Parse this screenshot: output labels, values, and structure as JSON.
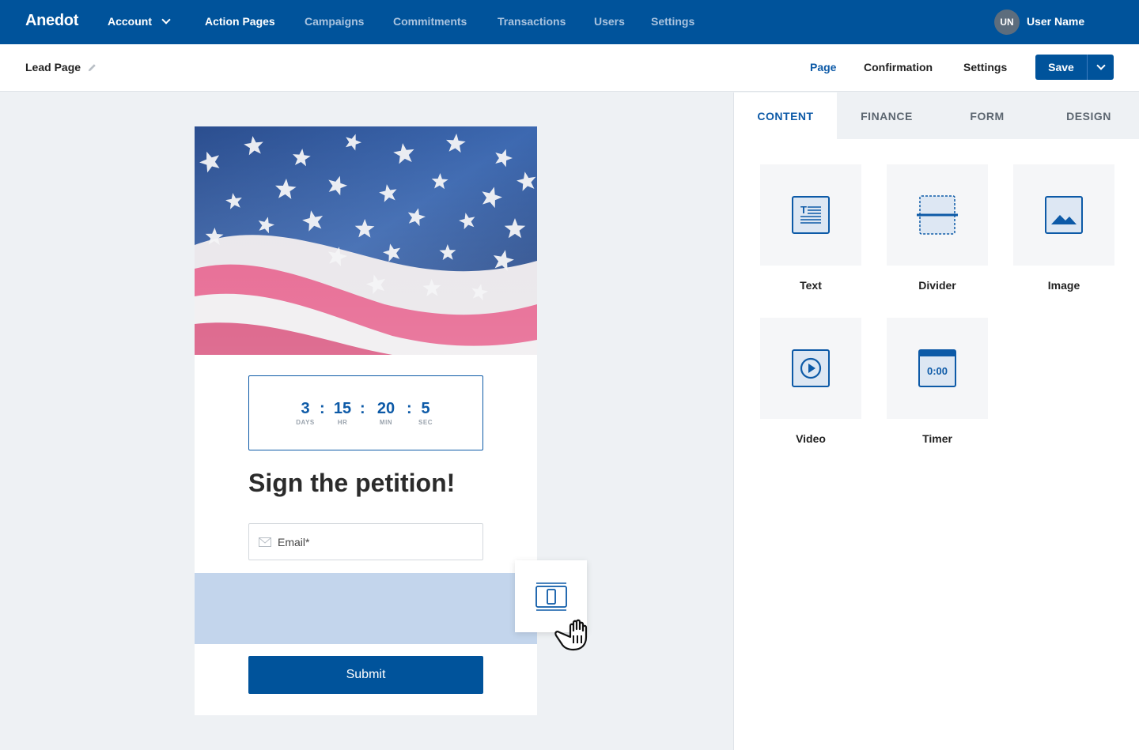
{
  "topnav": {
    "brand": "Anedot",
    "account": "Account",
    "items": [
      "Action Pages",
      "Campaigns",
      "Commitments",
      "Transactions",
      "Users",
      "Settings"
    ],
    "user_initials": "UN",
    "user_name": "User Name"
  },
  "subbar": {
    "page_name": "Lead Page",
    "tabs": [
      "Page",
      "Confirmation",
      "Settings"
    ],
    "active_tab": "Page",
    "save_label": "Save"
  },
  "preview": {
    "timer": {
      "days": "3",
      "hours": "15",
      "minutes": "20",
      "seconds": "5",
      "days_label": "DAYS",
      "hours_label": "HR",
      "minutes_label": "MIN",
      "seconds_label": "SEC",
      "separator": ":"
    },
    "heading": "Sign the petition!",
    "email_placeholder": "Email*",
    "submit_label": "Submit"
  },
  "panel": {
    "tabs": [
      "CONTENT",
      "FINANCE",
      "FORM",
      "DESIGN"
    ],
    "active_tab": "CONTENT",
    "blocks": [
      {
        "label": "Text",
        "icon": "text-block-icon"
      },
      {
        "label": "Divider",
        "icon": "divider-block-icon"
      },
      {
        "label": "Image",
        "icon": "image-block-icon"
      },
      {
        "label": "Video",
        "icon": "video-block-icon"
      },
      {
        "label": "Timer",
        "icon": "timer-block-icon",
        "icon_text": "0:00"
      }
    ]
  },
  "colors": {
    "brand_blue": "#00539b",
    "accent_blue": "#0d5aa7",
    "drop_zone": "#c3d5ec"
  }
}
